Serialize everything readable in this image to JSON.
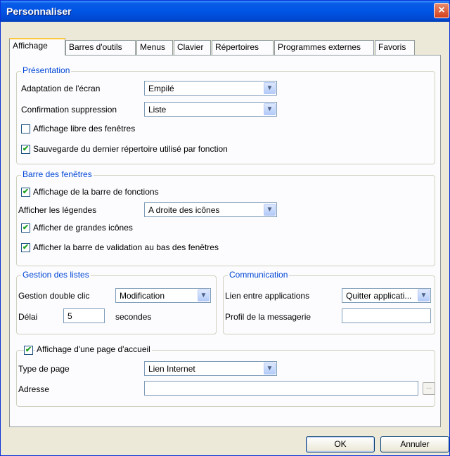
{
  "window": {
    "title": "Personnaliser",
    "close_icon": "×"
  },
  "tabs": [
    {
      "label": "Affichage",
      "active": true
    },
    {
      "label": "Barres d'outils"
    },
    {
      "label": "Menus"
    },
    {
      "label": "Clavier"
    },
    {
      "label": "Répertoires"
    },
    {
      "label": "Programmes externes"
    },
    {
      "label": "Favoris"
    }
  ],
  "presentation": {
    "title": "Présentation",
    "adaptation_label": "Adaptation de l'écran",
    "adaptation_value": "Empilé",
    "confirmation_label": "Confirmation suppression",
    "confirmation_value": "Liste",
    "libre_label": "Affichage libre des fenêtres",
    "libre_checked": false,
    "sauvegarde_label": "Sauvegarde du dernier répertoire utilisé par fonction",
    "sauvegarde_checked": true
  },
  "barre": {
    "title": "Barre des fenêtres",
    "fonctions_label": "Affichage de la barre de fonctions",
    "legendes_label": "Afficher les légendes",
    "legendes_value": "A droite des icônes",
    "grandes_icones_label": "Afficher de grandes icônes",
    "validation_label": "Afficher la barre de validation au bas des fenêtres"
  },
  "listes": {
    "title": "Gestion des listes",
    "double_clic_label": "Gestion double clic",
    "double_clic_value": "Modification",
    "delai_label": "Délai",
    "delai_value": "5",
    "secondes_label": "secondes"
  },
  "communication": {
    "title": "Communication",
    "lien_label": "Lien entre applications",
    "lien_value": "Quitter applicati...",
    "profil_label": "Profil de la messagerie",
    "profil_value": ""
  },
  "accueil": {
    "title": "Affichage d'une page d'accueil",
    "type_label": "Type de page",
    "type_value": "Lien Internet",
    "adresse_label": "Adresse",
    "adresse_value": "",
    "browse_label": "..."
  },
  "buttons": {
    "ok": "OK",
    "cancel": "Annuler"
  },
  "icons": {
    "check": "✔",
    "dropdown": "▼"
  }
}
